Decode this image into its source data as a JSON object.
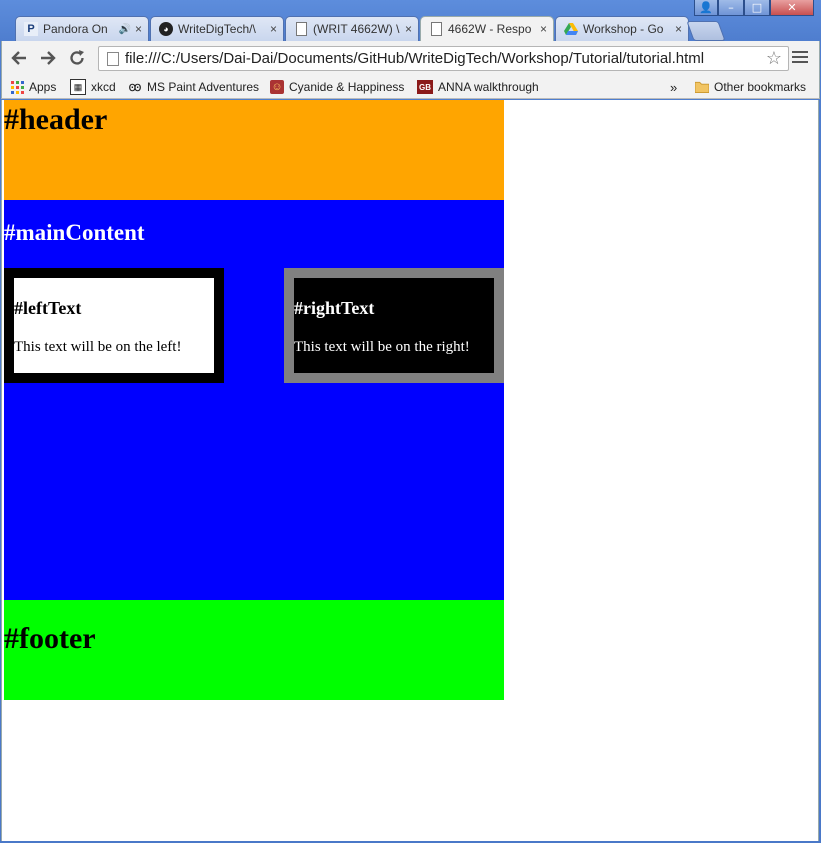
{
  "browser": {
    "tabs": [
      {
        "label": "Pandora On",
        "icon": "P",
        "audio": true
      },
      {
        "label": "WriteDigTech/\\",
        "icon": "github"
      },
      {
        "label": "(WRIT 4662W) \\",
        "icon": "page"
      },
      {
        "label": "4662W - Respo",
        "icon": "page",
        "active": true
      },
      {
        "label": "Workshop - Go",
        "icon": "drive"
      }
    ],
    "tab_close": "×",
    "url": "file:///C:/Users/Dai-Dai/Documents/GitHub/WriteDigTech/Workshop/Tutorial/tutorial.html",
    "bookmarks": [
      {
        "label": "Apps",
        "icon": "apps-icon"
      },
      {
        "label": "xkcd",
        "icon": "xkcd-icon"
      },
      {
        "label": "MS Paint Adventures",
        "icon": "mspa-icon"
      },
      {
        "label": "Cyanide & Happiness",
        "icon": "cyanide-icon"
      },
      {
        "label": "ANNA walkthrough",
        "icon": "anna-icon"
      }
    ],
    "overflow": "»",
    "other_bookmarks": "Other bookmarks"
  },
  "page": {
    "header": "#header",
    "main_content": "#mainContent",
    "left": {
      "heading": "#leftText",
      "text": "This text will be on the left!"
    },
    "right": {
      "heading": "#rightText",
      "text": "This text will be on the right!"
    },
    "footer": "#footer"
  },
  "colors": {
    "header": "#ffa500",
    "main": "#0000ff",
    "footer": "#00ff00",
    "left_border": "#000000",
    "right_border": "#808080"
  }
}
